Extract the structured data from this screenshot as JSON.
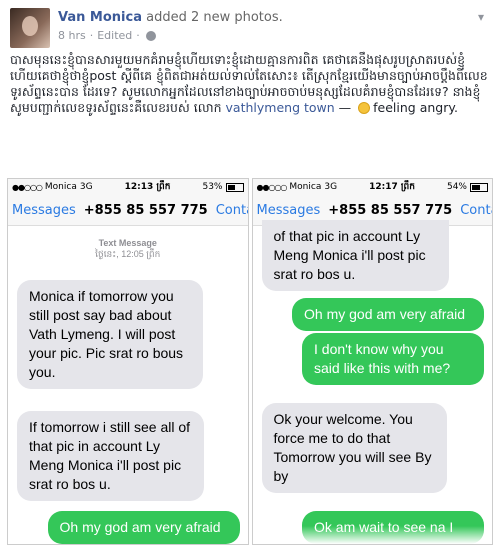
{
  "post": {
    "author": "Van Monica",
    "action": " added 2 new photos.",
    "time": "8 hrs",
    "edited": "Edited",
    "body": "បាសមុននេះខ្ញុំបានសារមួយមកគំរាមខ្ញុំហើយទោះខ្ញុំដោយគ្មានការពិត គេថាគេនឹងផុសរូបស្រាតរបស់ខ្ញុំហើយគេថាខ្ញុំថាខ្ញុំpost ស្តីពីគេ ខ្ញុំពិតជាអត់យល់ទាល់តែសោះ៖ តើស្រុកខ្មែរយើងមានច្បាប់អាចប្តឹងពីលេខទូរស័ព្ទនេះបាន ដែរទេ? សូមលោកអ្នកដែលនៅខាងច្បាប់អាចចាប់មនុស្សដែលគំរាមខ្ញុំបានដែរទេ? នាងខ្ញុំសូមបញ្ជាក់លេខទូរស័ព្ទនេះគឺលេខរបស់ លោក ",
    "tagged": "vathlymeng town",
    "feeling": " — ",
    "feeling_text": "feeling angry."
  },
  "left_phone": {
    "carrier": "Monica",
    "network": "3G",
    "clock": "12:13 ព្រឹក",
    "battery_text": "53%",
    "battery_level": 0.53,
    "nav_back": "Messages",
    "nav_title": "+855 85 557 775",
    "nav_contact": "Contact",
    "timestamp_label": "Text Message",
    "timestamp_value": "ថ្ងៃនេះ, 12:05 ព្រឹក",
    "messages": [
      {
        "dir": "in",
        "text": "Monica if tomorrow you still post say bad about Vath Lymeng. I will post your pic.  Pic srat ro bous you."
      },
      {
        "dir": "in",
        "text": "If tomorrow i still see all of that pic in account Ly Meng Monica i'll post pic srat ro bos u."
      },
      {
        "dir": "out",
        "text": "Oh my god am very afraid"
      }
    ]
  },
  "right_phone": {
    "carrier": "Monica",
    "network": "3G",
    "clock": "12:17 ព្រឹក",
    "battery_text": "54%",
    "battery_level": 0.54,
    "nav_back": "Messages",
    "nav_title": "+855 85 557 775",
    "nav_contact": "Contact",
    "messages": [
      {
        "dir": "in",
        "text": "of that pic in account Ly Meng Monica i'll post pic srat ro bos u."
      },
      {
        "dir": "out",
        "text": "Oh my god am very afraid"
      },
      {
        "dir": "out",
        "text": "I don't know why you said like this with me?"
      },
      {
        "dir": "in",
        "text": "Ok your welcome. You force me to do that Tomorrow you will see By by"
      },
      {
        "dir": "out",
        "text": "Ok am wait to see na I"
      }
    ]
  }
}
